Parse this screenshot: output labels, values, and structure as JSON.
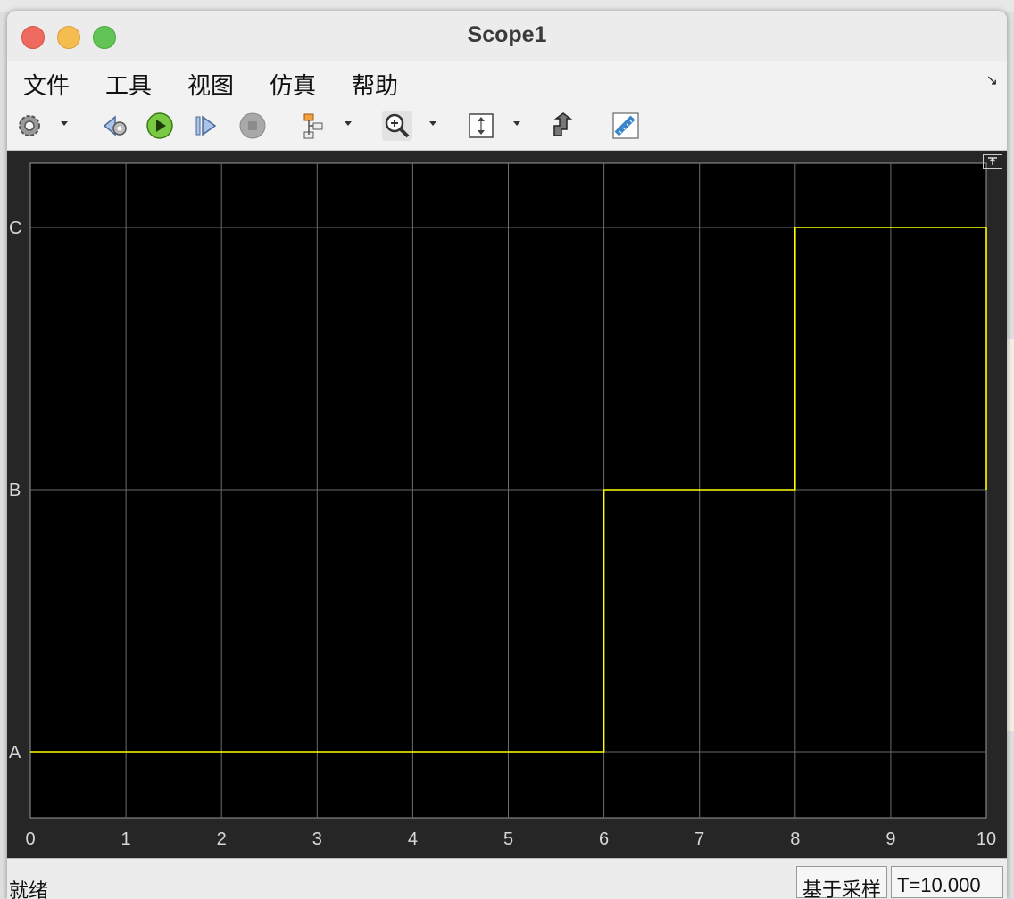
{
  "window": {
    "title": "Scope1"
  },
  "menu": {
    "items": [
      "文件",
      "工具",
      "视图",
      "仿真",
      "帮助"
    ]
  },
  "toolbar": {
    "icons": [
      "gear-icon",
      "step-back-icon",
      "run-icon",
      "step-forward-icon",
      "stop-icon",
      "signal-select-icon",
      "zoom-in-icon",
      "scale-axes-icon",
      "highlight-block-icon",
      "measure-icon"
    ]
  },
  "status": {
    "text": "就绪",
    "mode": "基于采样",
    "time": "T=10.000"
  },
  "colors": {
    "line": "#ffff00",
    "plot_bg": "#000000",
    "frame_bg": "#262626",
    "grid": "#6a6a6a"
  },
  "chart_data": {
    "type": "line",
    "x_ticks": [
      "0",
      "1",
      "2",
      "3",
      "4",
      "5",
      "6",
      "7",
      "8",
      "9",
      "10"
    ],
    "y_categories": [
      "A",
      "B",
      "C"
    ],
    "xlim": [
      0,
      10
    ],
    "grid": true,
    "series": [
      {
        "x": [
          0,
          6,
          6,
          8,
          8,
          10,
          10
        ],
        "y": [
          "A",
          "A",
          "B",
          "B",
          "C",
          "C",
          "B"
        ],
        "step": true
      }
    ]
  }
}
